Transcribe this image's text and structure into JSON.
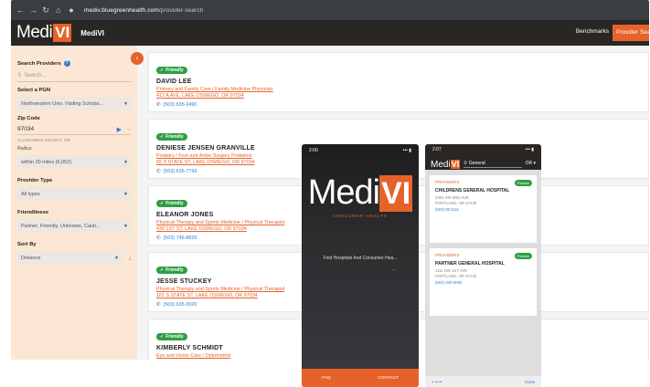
{
  "browser": {
    "url_host": "mediv.bluegreenhealth.com",
    "url_path": "/provider-search"
  },
  "app": {
    "logo_main": "Medi",
    "logo_accent": "VI",
    "name": "MediVI",
    "benchmarks": "Benchmarks",
    "provider_search": "Provider Sea..."
  },
  "sidebar": {
    "search_label": "Search Providers",
    "search_placeholder": "Search...",
    "plan_label": "Select a PGN",
    "plan_value": "Northwestern Univ. Visiting Scholar...",
    "zip_label": "Zip Code",
    "zip_value": "97034",
    "county": "CLACKAMAS COUNTY, OR",
    "radius_label": "Radius",
    "radius_value": "within 20 miles (6,052)",
    "type_label": "Provider Type",
    "type_value": "All types",
    "friendliness_label": "Friendliness",
    "friendliness_value": "Partner, Friendly, Unknown, Cauti...",
    "sort_label": "Sort By",
    "sort_value": "Distance"
  },
  "providers": [
    {
      "badge": "Friendly",
      "name": "DAVID LEE",
      "specialty": "Primary and Family Care / Family Medicine Physician",
      "address": "412 A AVE, LAKE OSWEGO, OR 97034",
      "phone": "(503) 635-2490"
    },
    {
      "badge": "Friendly",
      "name": "DENIESE JENSEN GRANVILLE",
      "specialty": "Podiatry / Foot and Ankle Surgery Podiatrist",
      "address": "55 S STATE ST, LAKE OSWEGO, OR 97034",
      "phone": "(503) 635-7743"
    },
    {
      "badge": "Friendly",
      "name": "ELEANOR JONES",
      "specialty": "Physical Therapy and Sports Medicine / Physical Therapist",
      "address": "430 1ST ST, LAKE OSWEGO, OR 97034",
      "phone": "(503) 746-8826"
    },
    {
      "badge": "Friendly",
      "name": "JESSE STUCKEY",
      "specialty": "Physical Therapy and Sports Medicine / Physical Therapist",
      "address": "101 S STATE ST, LAKE OSWEGO, OR 97034",
      "phone": "(503) 635-3020"
    },
    {
      "badge": "Friendly",
      "name": "KIMBERLY SCHMIDT",
      "specialty": "Eye and Vision Care / Optometrist",
      "address": "",
      "phone": ""
    }
  ],
  "phone1": {
    "time": "2:00",
    "signal": "••• ▮",
    "logo_main": "Medi",
    "logo_accent": "VI",
    "tagline": "CONSUMER HEALTH",
    "find": "Find Hospitals And Consumer Hea...",
    "dots": "...",
    "foot_left": "FAQ",
    "foot_right": "CONTACT"
  },
  "phone2": {
    "time": "2:07",
    "signal": "••• ▮",
    "logo_main": "Medi",
    "logo_accent": "VI",
    "search": "General",
    "menu": "OR ▾",
    "cards": [
      {
        "kind": "PROVIDERS",
        "badge": "Partner",
        "name": "CHILDRENS GENERAL HOSPITAL",
        "addr1": "3303 SW 3ND AVE",
        "addr2": "PORTLAND, OR 97240",
        "phone": "(503) 00-1111"
      },
      {
        "kind": "PROVIDERS",
        "badge": "Partner",
        "name": "PARTNER GENERAL HOSPITAL",
        "addr1": "1111 SW 1ST AVE",
        "addr2": "PORTLAND, OR 97240",
        "phone": "(503) 000-0000"
      }
    ],
    "bottom_left": "< •• ••",
    "bottom_right": "Done"
  },
  "colors": {
    "accent": "#e7622a",
    "dark": "#2a2623",
    "friendly": "#2f9e44",
    "link": "#2f7fd1"
  }
}
